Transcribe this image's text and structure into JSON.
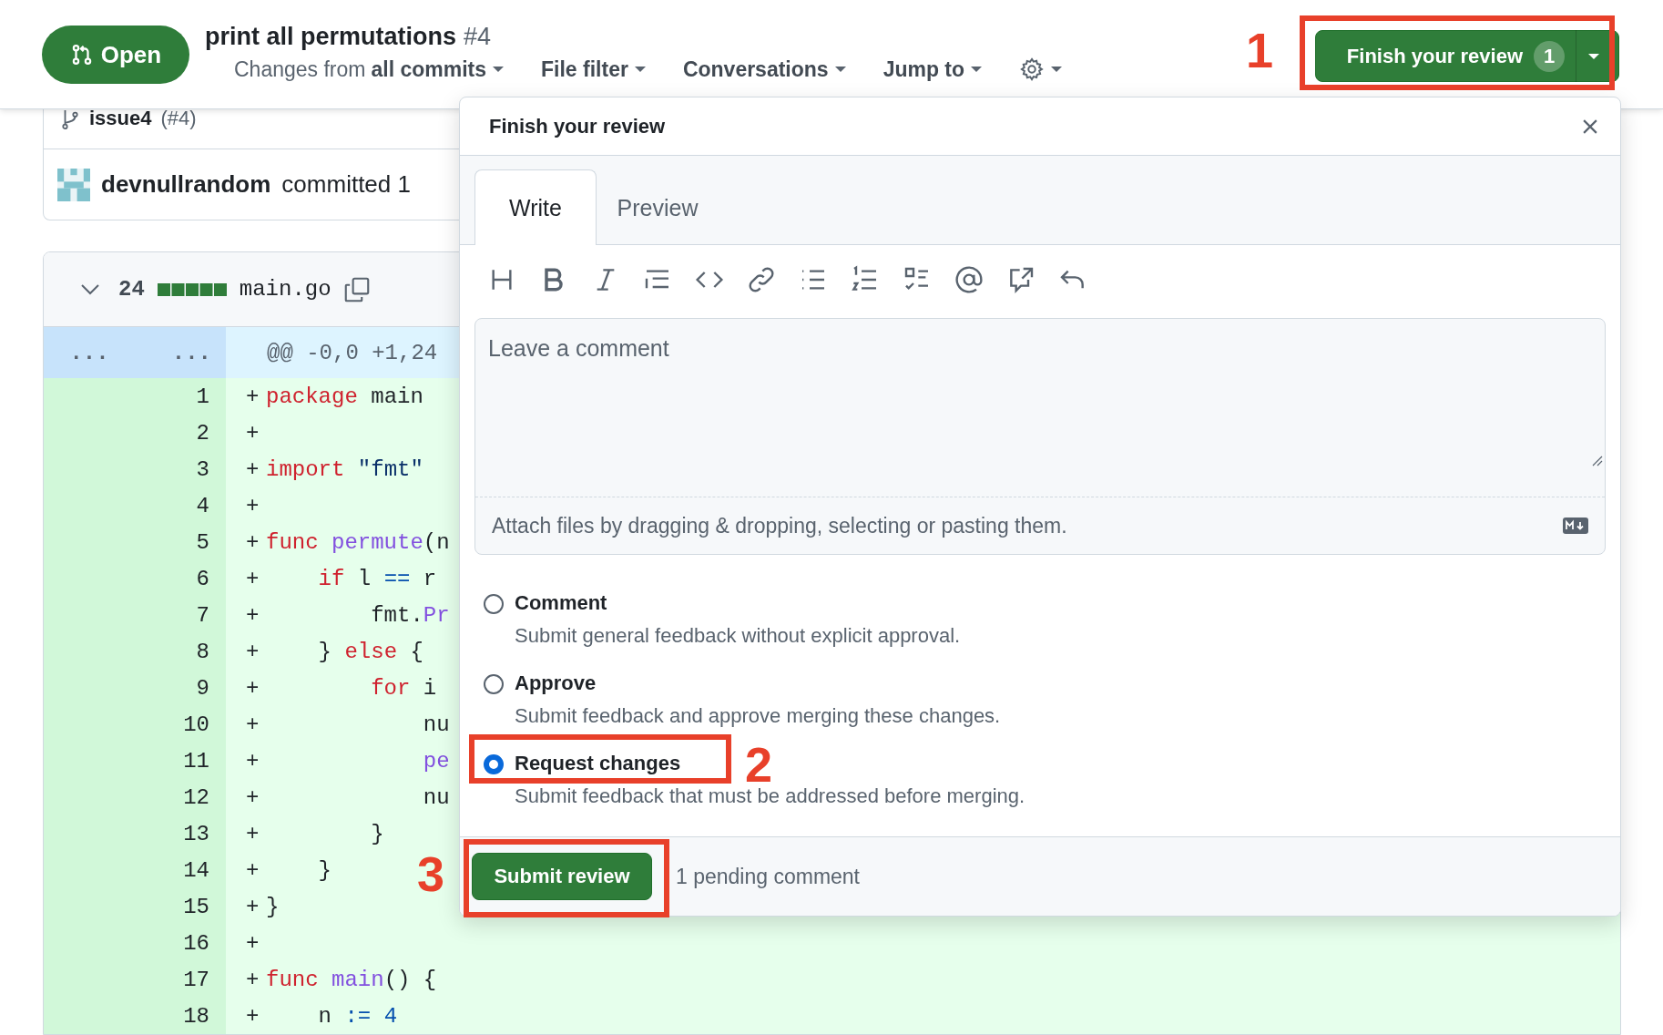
{
  "header": {
    "status": {
      "label": "Open"
    },
    "title": "print all permutations",
    "number": "#4",
    "nav": [
      {
        "kind": "range",
        "label": "Changes from",
        "value": "all commits"
      },
      {
        "kind": "menu",
        "label": "File filter"
      },
      {
        "kind": "menu",
        "label": "Conversations"
      },
      {
        "kind": "menu",
        "label": "Jump to"
      },
      {
        "kind": "settings"
      }
    ],
    "review_button": {
      "label": "Finish your review",
      "count": "1"
    }
  },
  "commit_box": {
    "branch": "issue4",
    "pr_ref": "(#4)",
    "author": "devnullrandom",
    "action": "committed 1"
  },
  "file": {
    "expanded": true,
    "changes": "24",
    "name": "main.go",
    "hunk": {
      "old": "...",
      "new": "...",
      "header": "@@ -0,0 +1,24"
    },
    "lines": [
      {
        "number": "1",
        "sign": "+",
        "tokens": [
          {
            "text": "package",
            "kind": "keyword"
          },
          {
            "text": " main",
            "kind": "plain"
          }
        ]
      },
      {
        "number": "2",
        "sign": "+"
      },
      {
        "number": "3",
        "sign": "+",
        "tokens": [
          {
            "text": "import",
            "kind": "keyword"
          },
          {
            "text": " \"fmt\"",
            "kind": "string"
          }
        ]
      },
      {
        "number": "4",
        "sign": "+"
      },
      {
        "number": "5",
        "sign": "+",
        "tokens": [
          {
            "text": "func",
            "kind": "keyword"
          },
          {
            "text": " permute",
            "kind": "function"
          },
          {
            "text": "(n",
            "kind": "plain"
          }
        ]
      },
      {
        "number": "6",
        "sign": "+",
        "tokens": [
          {
            "text": "    if",
            "kind": "keyword"
          },
          {
            "text": " l ",
            "kind": "plain"
          },
          {
            "text": "==",
            "kind": "operator"
          },
          {
            "text": " r",
            "kind": "plain"
          }
        ]
      },
      {
        "number": "7",
        "sign": "+",
        "tokens": [
          {
            "text": "        fmt.",
            "kind": "plain"
          },
          {
            "text": "Pr",
            "kind": "function"
          }
        ]
      },
      {
        "number": "8",
        "sign": "+",
        "tokens": [
          {
            "text": "    } ",
            "kind": "plain"
          },
          {
            "text": "else",
            "kind": "keyword"
          },
          {
            "text": " {",
            "kind": "plain"
          }
        ]
      },
      {
        "number": "9",
        "sign": "+",
        "tokens": [
          {
            "text": "        for",
            "kind": "keyword"
          },
          {
            "text": " i",
            "kind": "plain"
          }
        ]
      },
      {
        "number": "10",
        "sign": "+",
        "tokens": [
          {
            "text": "            nu",
            "kind": "plain"
          }
        ]
      },
      {
        "number": "11",
        "sign": "+",
        "tokens": [
          {
            "text": "            pe",
            "kind": "function"
          }
        ]
      },
      {
        "number": "12",
        "sign": "+",
        "tokens": [
          {
            "text": "            nu",
            "kind": "plain"
          }
        ]
      },
      {
        "number": "13",
        "sign": "+",
        "tokens": [
          {
            "text": "        }",
            "kind": "plain"
          }
        ]
      },
      {
        "number": "14",
        "sign": "+",
        "tokens": [
          {
            "text": "    }",
            "kind": "plain"
          }
        ]
      },
      {
        "number": "15",
        "sign": "+",
        "tokens": [
          {
            "text": "}",
            "kind": "plain"
          }
        ]
      },
      {
        "number": "16",
        "sign": "+"
      },
      {
        "number": "17",
        "sign": "+",
        "tokens": [
          {
            "text": "func",
            "kind": "keyword"
          },
          {
            "text": " main",
            "kind": "function"
          },
          {
            "text": "() {",
            "kind": "plain"
          }
        ]
      },
      {
        "number": "18",
        "sign": "+",
        "tokens": [
          {
            "text": "    n ",
            "kind": "plain"
          },
          {
            "text": ":=",
            "kind": "operator"
          },
          {
            "text": " 4",
            "kind": "number"
          }
        ]
      }
    ]
  },
  "review_popup": {
    "title": "Finish your review",
    "tabs": [
      {
        "label": "Write",
        "selected": true
      },
      {
        "label": "Preview",
        "selected": false
      }
    ],
    "toolbar": [
      {
        "kind": "heading"
      },
      {
        "kind": "bold"
      },
      {
        "kind": "italic"
      },
      {
        "kind": "quote"
      },
      {
        "kind": "code"
      },
      {
        "kind": "link"
      },
      {
        "kind": "bullets"
      },
      {
        "kind": "numbers"
      },
      {
        "kind": "tasks"
      },
      {
        "kind": "mention"
      },
      {
        "kind": "reference"
      },
      {
        "kind": "undo"
      }
    ],
    "comment": {
      "placeholder": "Leave a comment"
    },
    "attach_hint": "Attach files by dragging & dropping, selecting or pasting them.",
    "options": [
      {
        "label": "Comment",
        "description": "Submit general feedback without explicit approval.",
        "selected": false
      },
      {
        "label": "Approve",
        "description": "Submit feedback and approve merging these changes.",
        "selected": false
      },
      {
        "label": "Request changes",
        "description": "Submit feedback that must be addressed before merging.",
        "selected": true
      }
    ],
    "submit": {
      "label": "Submit review"
    },
    "pending": "1 pending comment"
  },
  "annotations": [
    {
      "label": "1",
      "kind": "review_button"
    },
    {
      "label": "2",
      "kind": "option"
    },
    {
      "label": "3",
      "kind": "submit"
    }
  ]
}
